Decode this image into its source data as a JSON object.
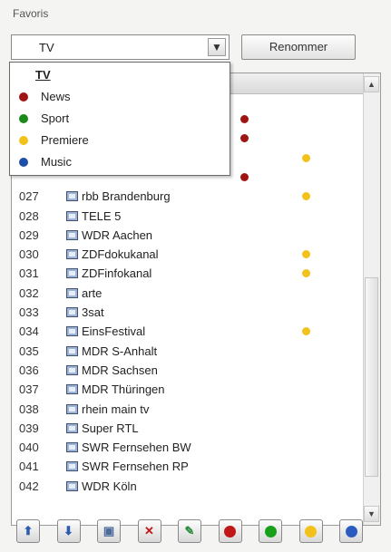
{
  "header": {
    "favoris_label": "Favoris"
  },
  "combo": {
    "selected": "TV",
    "arrow": "chevron-down-icon"
  },
  "rename_button": {
    "label": "Renommer"
  },
  "dropdown": {
    "items": [
      {
        "label": "TV",
        "color": ""
      },
      {
        "label": "News",
        "color": "#a01414"
      },
      {
        "label": "Sport",
        "color": "#1a8a1a"
      },
      {
        "label": "Premiere",
        "color": "#f2c21a"
      },
      {
        "label": "Music",
        "color": "#1e4fa8"
      }
    ]
  },
  "colors": {
    "red": "#a01414",
    "green": "#1a8a1a",
    "yellow": "#f2c21a",
    "blue": "#1e4fa8"
  },
  "channels": [
    {
      "num": "",
      "name": "",
      "dot": "red"
    },
    {
      "num": "",
      "name": "",
      "dot": "red"
    },
    {
      "num": "",
      "name": "",
      "dot": "yellow"
    },
    {
      "num": "",
      "name": "",
      "dot": "red"
    },
    {
      "num": "027",
      "name": "rbb Brandenburg",
      "dot": "yellow"
    },
    {
      "num": "028",
      "name": "TELE 5",
      "dot": ""
    },
    {
      "num": "029",
      "name": "WDR Aachen",
      "dot": ""
    },
    {
      "num": "030",
      "name": "ZDFdokukanal",
      "dot": "yellow"
    },
    {
      "num": "031",
      "name": "ZDFinfokanal",
      "dot": "yellow"
    },
    {
      "num": "032",
      "name": "arte",
      "dot": ""
    },
    {
      "num": "033",
      "name": "3sat",
      "dot": ""
    },
    {
      "num": "034",
      "name": "EinsFestival",
      "dot": "yellow"
    },
    {
      "num": "035",
      "name": "MDR S-Anhalt",
      "dot": ""
    },
    {
      "num": "036",
      "name": "MDR Sachsen",
      "dot": ""
    },
    {
      "num": "037",
      "name": "MDR Thüringen",
      "dot": ""
    },
    {
      "num": "038",
      "name": "rhein main tv",
      "dot": ""
    },
    {
      "num": "039",
      "name": "Super RTL",
      "dot": ""
    },
    {
      "num": "040",
      "name": "SWR Fernsehen BW",
      "dot": ""
    },
    {
      "num": "041",
      "name": "SWR Fernsehen RP",
      "dot": ""
    },
    {
      "num": "042",
      "name": "WDR Köln",
      "dot": ""
    }
  ],
  "toolbar": [
    {
      "name": "move-up-button",
      "icon": "arrow-up-icon",
      "glyph": "⬆",
      "color": "#2b5cb0"
    },
    {
      "name": "move-down-button",
      "icon": "arrow-down-icon",
      "glyph": "⬇",
      "color": "#2b5cb0"
    },
    {
      "name": "properties-button",
      "icon": "window-icon",
      "glyph": "▣",
      "color": "#4a6a9a"
    },
    {
      "name": "delete-button",
      "icon": "delete-x-icon",
      "glyph": "✕",
      "color": "#c01818"
    },
    {
      "name": "edit-button",
      "icon": "edit-icon",
      "glyph": "✎",
      "color": "#2a8a3a"
    },
    {
      "name": "red-button",
      "icon": "red-circle-icon",
      "circle": "#c01818"
    },
    {
      "name": "green-button",
      "icon": "green-circle-icon",
      "circle": "#18a018"
    },
    {
      "name": "yellow-button",
      "icon": "yellow-circle-icon",
      "circle": "#f2c21a"
    },
    {
      "name": "blue-button",
      "icon": "blue-circle-icon",
      "circle": "#2a5cc0"
    }
  ]
}
